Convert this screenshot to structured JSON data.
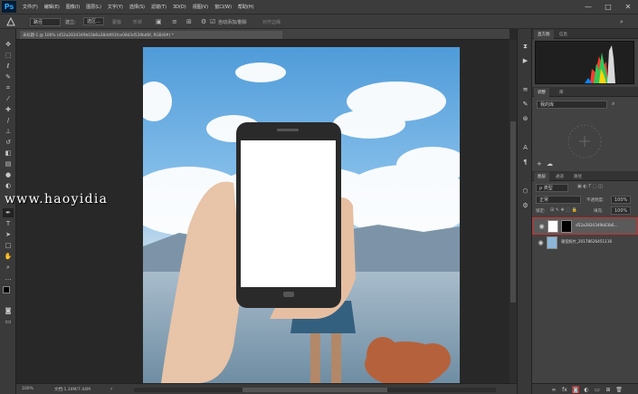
{
  "app": {
    "logo": "Ps"
  },
  "menu": [
    "文件(F)",
    "编辑(E)",
    "图像(I)",
    "图层(L)",
    "文字(Y)",
    "选择(S)",
    "滤镜(T)",
    "3D(D)",
    "视图(V)",
    "窗口(W)",
    "帮助(H)"
  ],
  "window_controls": {
    "minimize": "—",
    "maximize": "□",
    "close": "✕"
  },
  "options_bar": {
    "shape_mode": "路径",
    "make_label": "建立:",
    "selection_btn": "选区...",
    "mask_btn": "蒙版",
    "shape_btn": "形状",
    "auto_add_delete": "自动添加/删除",
    "align_edges": "对齐边缘"
  },
  "document": {
    "tab_label": "未标题-1 @ 100% (d52a2834349b03b6a38ddf41fce08d3d539bd6f, RGB/8#) *",
    "zoom": "100%",
    "doc_size": "文档:1.34M/7.44M"
  },
  "watermark": "www.haoyidia",
  "panels": {
    "top_tabs": [
      "直方图",
      "信息"
    ],
    "lib_tabs": [
      "调整",
      "库"
    ],
    "lib_field": "我的库",
    "layers_tabs": [
      "图层",
      "通道",
      "路径"
    ],
    "filter_kind": "ρ 类型",
    "blend_mode": "正常",
    "opacity_label": "不透明度:",
    "opacity_value": "100%",
    "lock_label": "锁定:",
    "fill_label": "填充:",
    "fill_value": "100%",
    "layers": [
      {
        "name": "d52a2834349b03b6..."
      },
      {
        "name": "寝室照片_20178626451116"
      }
    ]
  },
  "colors": {
    "accent": "#31a8ff",
    "selection": "#d22c2c",
    "panel": "#424242",
    "bg": "#282828"
  }
}
